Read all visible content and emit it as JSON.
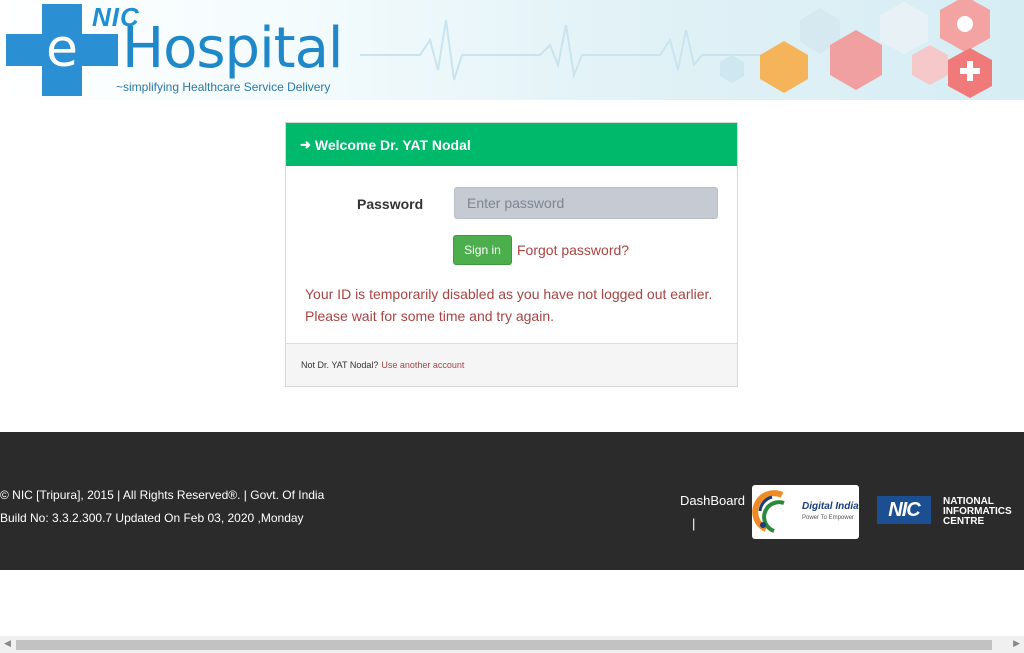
{
  "header": {
    "logo_nic": "NIC",
    "logo_e": "e",
    "logo_hospital": "Hospital",
    "tagline": "~simplifying Healthcare Service Delivery"
  },
  "login": {
    "welcome": "Welcome Dr. YAT Nodal",
    "password_label": "Password",
    "password_placeholder": "Enter password",
    "signin_label": "Sign in",
    "forgot_label": "Forgot password?",
    "error_line1": "Your ID is temporarily disabled as you have not logged out earlier.",
    "error_line2": "Please wait for some time and try again.",
    "not_user": "Not Dr. YAT Nodal?",
    "use_another": "Use another account"
  },
  "footer": {
    "copyright": "© NIC [Tripura], 2015 | All Rights Reserved®. | Govt. Of India",
    "build": "Build No: 3.3.2.300.7 Updated On Feb 03, 2020 ,Monday",
    "dashboard_label": "DashBoard",
    "separator": "|",
    "digital_india": "Digital India",
    "digital_india_sub": "Power To Empower",
    "nic_short": "NIC",
    "nic_full": "NATIONAL INFORMATICS CENTRE"
  },
  "colors": {
    "panel_header": "#00b96b",
    "signin_button": "#4cae4c",
    "error_text": "#a94442",
    "footer_bg": "#2b2b2b",
    "brand_blue": "#1e88c8"
  }
}
